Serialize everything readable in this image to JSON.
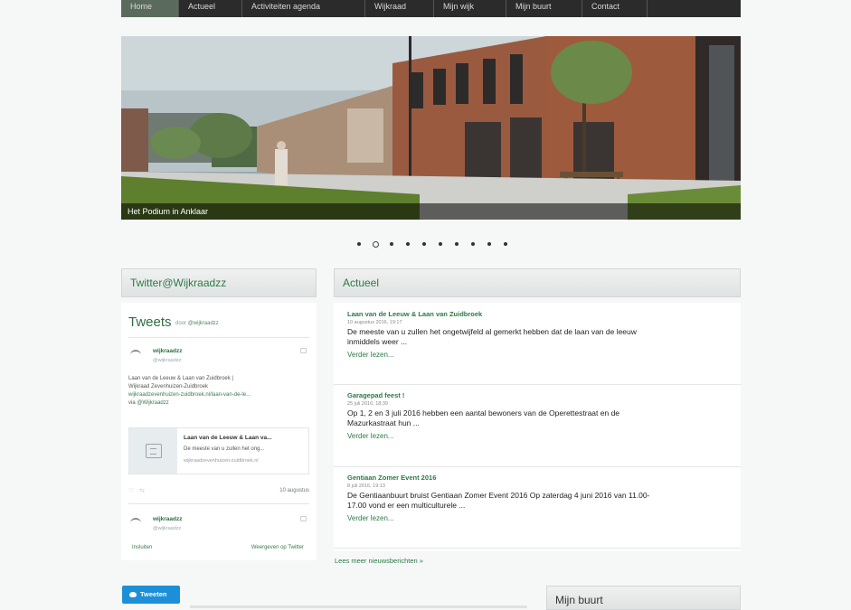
{
  "nav": {
    "items": [
      "Home",
      "Actueel",
      "Activiteiten agenda",
      "Wijkraad",
      "Mijn wijk",
      "Mijn buurt",
      "Contact"
    ]
  },
  "hero": {
    "caption": "Het Podium in Anklaar",
    "slide_count": 10,
    "active_slide": 1
  },
  "twitter": {
    "panel_title": "Twitter@Wijkraadzz",
    "widget_title": "Tweets",
    "widget_by_prefix": "door",
    "widget_by_handle": "@wijkraadzz",
    "tweet1": {
      "name": "wijkraadzz",
      "handle": "@wijkraadzz",
      "text_line1": "Laan van de Leeuw & Laan van Zuidbroek |",
      "text_line2": "Wijkraad Zevenhuizen-Zuidbroek",
      "text_link": "wijkraadzevenhuizen-zuidbroek.nl/laan-van-de-le...",
      "text_via_prefix": "via",
      "text_via": "@Wijkraadzz",
      "card_title": "Laan van de Leeuw & Laan va...",
      "card_desc": "De meeste van u zullen het ong...",
      "card_url": "wijkraadzevenhuizen-zuidbroek.nl",
      "date": "10 augustus"
    },
    "tweet2": {
      "name": "wijkraadzz",
      "handle": "@wijkraadzz"
    },
    "footer_left": "Insluiten",
    "footer_right": "Weergeven op Twitter",
    "tweet_button": "Tweeten"
  },
  "news": {
    "panel_title": "Actueel",
    "items": [
      {
        "title": "Laan van de Leeuw & Laan van Zuidbroek",
        "date": "10 augustus 2016, 19:17",
        "text": "De meeste van u zullen het ongetwijfeld al gemerkt hebben dat de laan van de leeuw inmiddels weer ...",
        "more": "Verder lezen..."
      },
      {
        "title": "Garagepad feest !",
        "date": "25 juli 2016, 18:39",
        "text": "Op 1, 2 en 3 juli 2016 hebben een aantal bewoners van de Operettestraat en de Mazurkastraat hun ...",
        "more": "Verder lezen..."
      },
      {
        "title": "Gentiaan Zomer Event 2016",
        "date": "8 juli 2016, 19:13",
        "text": "De Gentiaanbuurt bruist Gentiaan Zomer Event 2016 Op zaterdag 4 juni 2016 van 11.00-17.00 vond er een multiculturele ...",
        "more": "Verder lezen..."
      }
    ],
    "more_link": "Lees meer nieuwsberichten »"
  },
  "sidebar": {
    "buurt_title": "Mijn buurt"
  },
  "colors": {
    "accent_green": "#2b7a44",
    "nav_bg": "#2b2b2b",
    "twitter_blue": "#1d8fd8"
  }
}
